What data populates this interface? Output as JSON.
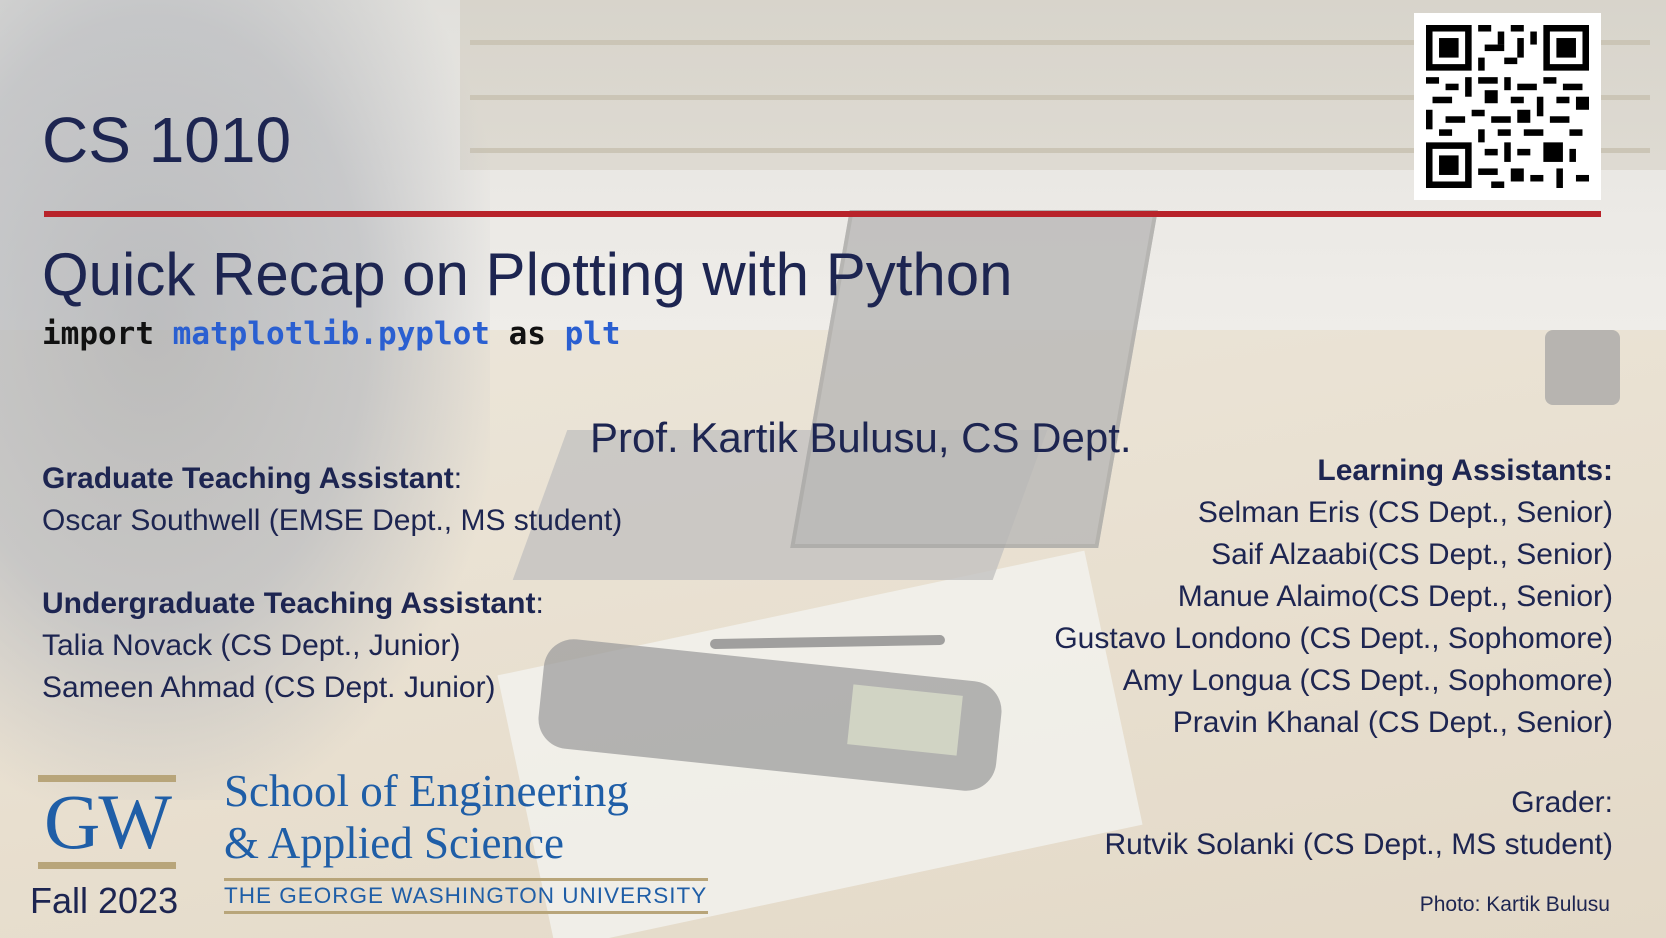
{
  "slide": {
    "course": "CS 1010",
    "title": "Quick Recap on Plotting with Python",
    "code": {
      "kw_import": "import",
      "module": "matplotlib.pyplot",
      "kw_as": "as",
      "alias": "plt"
    },
    "instructor": "Prof. Kartik Bulusu, CS Dept.",
    "grad_ta": {
      "heading": "Graduate Teaching Assistant",
      "names": [
        "Oscar Southwell (EMSE Dept., MS student)"
      ]
    },
    "undergrad_ta": {
      "heading": "Undergraduate Teaching Assistant",
      "names": [
        "Talia Novack (CS Dept., Junior)",
        "Sameen Ahmad (CS Dept. Junior)"
      ]
    },
    "learning_assistants": {
      "heading": "Learning Assistants:",
      "names": [
        "Selman Eris (CS Dept., Senior)",
        "Saif Alzaabi(CS Dept., Senior)",
        "Manue Alaimo(CS Dept., Senior)",
        "Gustavo Londono (CS Dept., Sophomore)",
        "Amy Longua (CS Dept., Sophomore)",
        "Pravin Khanal (CS Dept., Senior)"
      ]
    },
    "grader": {
      "heading": "Grader:",
      "name": "Rutvik Solanki (CS Dept., MS student)"
    },
    "photo_credit": "Photo: Kartik Bulusu",
    "term": "Fall 2023",
    "logo": {
      "gw": "GW",
      "school_line1": "School of Engineering",
      "school_line2": "& Applied Science",
      "university": "THE GEORGE WASHINGTON UNIVERSITY"
    },
    "colors": {
      "navy": "#1d2551",
      "rule_red": "#b8232a",
      "gw_blue": "#1f5ea7",
      "gw_gold": "#b8a57a",
      "code_blue": "#2a5fd1"
    }
  }
}
